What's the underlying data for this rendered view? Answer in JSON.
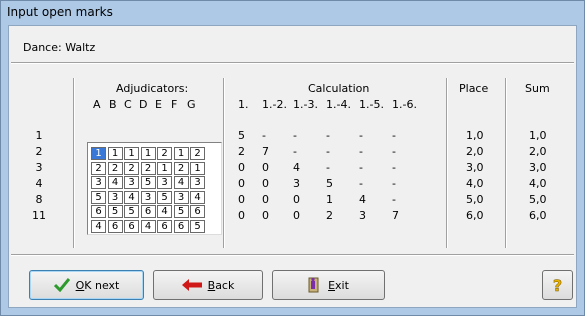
{
  "window": {
    "title": "Input open marks"
  },
  "dance": {
    "label": "Dance: Waltz"
  },
  "headers": {
    "adjudicators": "Adjudicators:",
    "calculation": "Calculation",
    "place": "Place",
    "sum": "Sum"
  },
  "adjudicator_letters": [
    "A",
    "B",
    "C",
    "D",
    "E",
    "F",
    "G"
  ],
  "calc_columns": [
    "1.",
    "1.-2.",
    "1.-3.",
    "1.-4.",
    "1.-5.",
    "1.-6."
  ],
  "rows": [
    {
      "couple": "1",
      "marks": [
        "1",
        "1",
        "1",
        "1",
        "2",
        "1",
        "2"
      ],
      "calc": [
        "5",
        "-",
        "-",
        "-",
        "-",
        "-"
      ],
      "place": "1,0",
      "sum": "1,0"
    },
    {
      "couple": "2",
      "marks": [
        "2",
        "2",
        "2",
        "2",
        "1",
        "2",
        "1"
      ],
      "calc": [
        "2",
        "7",
        "-",
        "-",
        "-",
        "-"
      ],
      "place": "2,0",
      "sum": "2,0"
    },
    {
      "couple": "3",
      "marks": [
        "3",
        "4",
        "3",
        "5",
        "3",
        "4",
        "3"
      ],
      "calc": [
        "0",
        "0",
        "4",
        "-",
        "-",
        "-"
      ],
      "place": "3,0",
      "sum": "3,0"
    },
    {
      "couple": "4",
      "marks": [
        "5",
        "3",
        "4",
        "3",
        "5",
        "3",
        "4"
      ],
      "calc": [
        "0",
        "0",
        "3",
        "5",
        "-",
        "-"
      ],
      "place": "4,0",
      "sum": "4,0"
    },
    {
      "couple": "8",
      "marks": [
        "6",
        "5",
        "5",
        "6",
        "4",
        "5",
        "6"
      ],
      "calc": [
        "0",
        "0",
        "0",
        "1",
        "4",
        "-"
      ],
      "place": "5,0",
      "sum": "5,0"
    },
    {
      "couple": "11",
      "marks": [
        "4",
        "6",
        "6",
        "4",
        "6",
        "6",
        "5"
      ],
      "calc": [
        "0",
        "0",
        "0",
        "2",
        "3",
        "7"
      ],
      "place": "6,0",
      "sum": "6,0"
    }
  ],
  "buttons": {
    "ok_mnemonic": "O",
    "ok_rest": "K next",
    "back_mnemonic": "B",
    "back_rest": "ack",
    "exit_mnemonic": "E",
    "exit_rest": "xit",
    "help": "?"
  },
  "colors": {
    "title_bg": "#aec9e6",
    "selected_cell": "#3a78d8",
    "check_green": "#2e9a2e",
    "back_arrow_red": "#d01818",
    "exit_purple": "#7b2fa8",
    "help_yellow": "#e8b000"
  },
  "icons": {
    "ok": "check-icon",
    "back": "arrow-left-icon",
    "exit": "exit-door-icon",
    "help": "help-icon"
  }
}
